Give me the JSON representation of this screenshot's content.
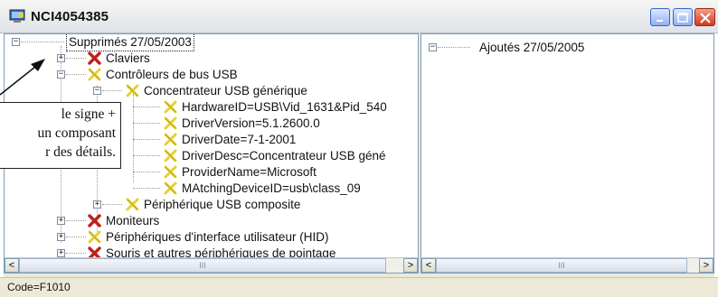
{
  "window": {
    "title": "NCI4054385",
    "minimize_label": "_",
    "maximize_label": "□",
    "close_label": "×"
  },
  "left_tree": {
    "root": {
      "label": "Supprimés 27/05/2003",
      "expander": "−"
    },
    "items": [
      {
        "label": "Claviers",
        "expander": "+",
        "icon": "red-x-icon"
      },
      {
        "label": "Contrôleurs de bus USB",
        "expander": "−",
        "icon": "yellow-x-icon"
      },
      {
        "label": "Concentrateur USB générique",
        "expander": "−",
        "icon": "yellow-x-icon"
      },
      {
        "label": "HardwareID=USB\\Vid_1631&Pid_540",
        "icon": "yellow-x-icon"
      },
      {
        "label": "DriverVersion=5.1.2600.0",
        "icon": "yellow-x-icon"
      },
      {
        "label": "DriverDate=7-1-2001",
        "icon": "yellow-x-icon"
      },
      {
        "label": "DriverDesc=Concentrateur USB géné",
        "icon": "yellow-x-icon"
      },
      {
        "label": "ProviderName=Microsoft",
        "icon": "yellow-x-icon"
      },
      {
        "label": "MAtchingDeviceID=usb\\class_09",
        "icon": "yellow-x-icon"
      },
      {
        "label": "Périphérique USB composite",
        "expander": "+",
        "icon": "yellow-x-icon"
      },
      {
        "label": "Moniteurs",
        "expander": "+",
        "icon": "red-x-icon"
      },
      {
        "label": "Périphériques d'interface utilisateur (HID)",
        "expander": "+",
        "icon": "yellow-x-icon"
      },
      {
        "label": "Souris et autres périphériques de pointage",
        "expander": "+",
        "icon": "red-x-icon"
      }
    ]
  },
  "right_tree": {
    "root": {
      "label": "Ajoutés 27/05/2005",
      "expander": "−"
    }
  },
  "scrollbars": {
    "left_arrow": "<",
    "right_arrow": ">",
    "thumb_grip": "III"
  },
  "status": {
    "text": "Code=F1010"
  },
  "callout": {
    "line1": "le signe +",
    "line2": "un composant",
    "line3": "r des détails."
  },
  "colors": {
    "red_x": "#c0201a",
    "yellow_x": "#e8d030",
    "pane_border": "#7f9db9"
  }
}
